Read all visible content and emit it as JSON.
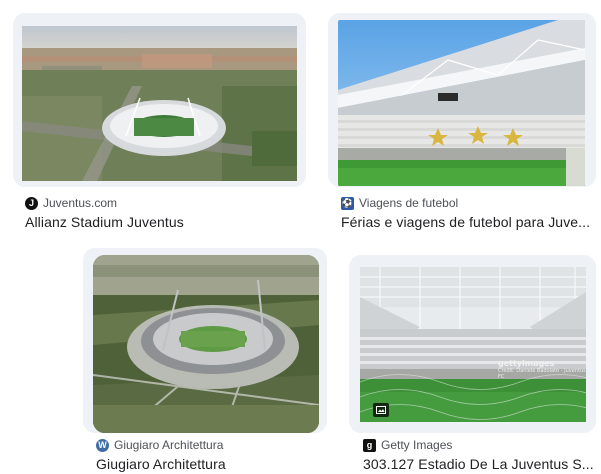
{
  "results": [
    {
      "source": "Juventus.com",
      "title": "Allianz Stadium Juventus",
      "favicon": "juventus-icon"
    },
    {
      "source": "Viagens de futebol",
      "title": "Férias e viagens de futebol para Juve...",
      "favicon": "viagens-icon"
    },
    {
      "source": "Giugiaro Architettura",
      "title": "Giugiaro Architettura",
      "favicon": "wordpress-icon"
    },
    {
      "source": "Getty Images",
      "title": "303.127 Estadio De La Juventus S...",
      "favicon": "getty-icon",
      "watermark": "gettyimages",
      "credit": "Credit: Daniele Badolato - Juventus FC"
    }
  ],
  "colors": {
    "title": "#202124",
    "source": "#4d5156",
    "card_bg": "#eef1f5"
  }
}
